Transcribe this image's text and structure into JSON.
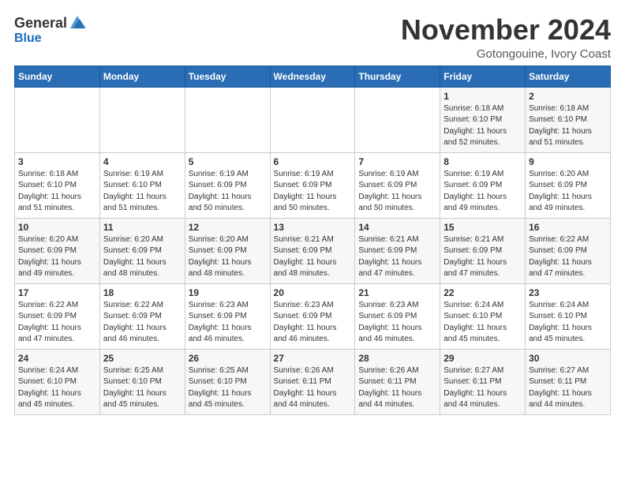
{
  "logo": {
    "general": "General",
    "blue": "Blue"
  },
  "header": {
    "month": "November 2024",
    "location": "Gotongouine, Ivory Coast"
  },
  "weekdays": [
    "Sunday",
    "Monday",
    "Tuesday",
    "Wednesday",
    "Thursday",
    "Friday",
    "Saturday"
  ],
  "weeks": [
    [
      {
        "day": "",
        "info": ""
      },
      {
        "day": "",
        "info": ""
      },
      {
        "day": "",
        "info": ""
      },
      {
        "day": "",
        "info": ""
      },
      {
        "day": "",
        "info": ""
      },
      {
        "day": "1",
        "info": "Sunrise: 6:18 AM\nSunset: 6:10 PM\nDaylight: 11 hours\nand 52 minutes."
      },
      {
        "day": "2",
        "info": "Sunrise: 6:18 AM\nSunset: 6:10 PM\nDaylight: 11 hours\nand 51 minutes."
      }
    ],
    [
      {
        "day": "3",
        "info": "Sunrise: 6:18 AM\nSunset: 6:10 PM\nDaylight: 11 hours\nand 51 minutes."
      },
      {
        "day": "4",
        "info": "Sunrise: 6:19 AM\nSunset: 6:10 PM\nDaylight: 11 hours\nand 51 minutes."
      },
      {
        "day": "5",
        "info": "Sunrise: 6:19 AM\nSunset: 6:09 PM\nDaylight: 11 hours\nand 50 minutes."
      },
      {
        "day": "6",
        "info": "Sunrise: 6:19 AM\nSunset: 6:09 PM\nDaylight: 11 hours\nand 50 minutes."
      },
      {
        "day": "7",
        "info": "Sunrise: 6:19 AM\nSunset: 6:09 PM\nDaylight: 11 hours\nand 50 minutes."
      },
      {
        "day": "8",
        "info": "Sunrise: 6:19 AM\nSunset: 6:09 PM\nDaylight: 11 hours\nand 49 minutes."
      },
      {
        "day": "9",
        "info": "Sunrise: 6:20 AM\nSunset: 6:09 PM\nDaylight: 11 hours\nand 49 minutes."
      }
    ],
    [
      {
        "day": "10",
        "info": "Sunrise: 6:20 AM\nSunset: 6:09 PM\nDaylight: 11 hours\nand 49 minutes."
      },
      {
        "day": "11",
        "info": "Sunrise: 6:20 AM\nSunset: 6:09 PM\nDaylight: 11 hours\nand 48 minutes."
      },
      {
        "day": "12",
        "info": "Sunrise: 6:20 AM\nSunset: 6:09 PM\nDaylight: 11 hours\nand 48 minutes."
      },
      {
        "day": "13",
        "info": "Sunrise: 6:21 AM\nSunset: 6:09 PM\nDaylight: 11 hours\nand 48 minutes."
      },
      {
        "day": "14",
        "info": "Sunrise: 6:21 AM\nSunset: 6:09 PM\nDaylight: 11 hours\nand 47 minutes."
      },
      {
        "day": "15",
        "info": "Sunrise: 6:21 AM\nSunset: 6:09 PM\nDaylight: 11 hours\nand 47 minutes."
      },
      {
        "day": "16",
        "info": "Sunrise: 6:22 AM\nSunset: 6:09 PM\nDaylight: 11 hours\nand 47 minutes."
      }
    ],
    [
      {
        "day": "17",
        "info": "Sunrise: 6:22 AM\nSunset: 6:09 PM\nDaylight: 11 hours\nand 47 minutes."
      },
      {
        "day": "18",
        "info": "Sunrise: 6:22 AM\nSunset: 6:09 PM\nDaylight: 11 hours\nand 46 minutes."
      },
      {
        "day": "19",
        "info": "Sunrise: 6:23 AM\nSunset: 6:09 PM\nDaylight: 11 hours\nand 46 minutes."
      },
      {
        "day": "20",
        "info": "Sunrise: 6:23 AM\nSunset: 6:09 PM\nDaylight: 11 hours\nand 46 minutes."
      },
      {
        "day": "21",
        "info": "Sunrise: 6:23 AM\nSunset: 6:09 PM\nDaylight: 11 hours\nand 46 minutes."
      },
      {
        "day": "22",
        "info": "Sunrise: 6:24 AM\nSunset: 6:10 PM\nDaylight: 11 hours\nand 45 minutes."
      },
      {
        "day": "23",
        "info": "Sunrise: 6:24 AM\nSunset: 6:10 PM\nDaylight: 11 hours\nand 45 minutes."
      }
    ],
    [
      {
        "day": "24",
        "info": "Sunrise: 6:24 AM\nSunset: 6:10 PM\nDaylight: 11 hours\nand 45 minutes."
      },
      {
        "day": "25",
        "info": "Sunrise: 6:25 AM\nSunset: 6:10 PM\nDaylight: 11 hours\nand 45 minutes."
      },
      {
        "day": "26",
        "info": "Sunrise: 6:25 AM\nSunset: 6:10 PM\nDaylight: 11 hours\nand 45 minutes."
      },
      {
        "day": "27",
        "info": "Sunrise: 6:26 AM\nSunset: 6:11 PM\nDaylight: 11 hours\nand 44 minutes."
      },
      {
        "day": "28",
        "info": "Sunrise: 6:26 AM\nSunset: 6:11 PM\nDaylight: 11 hours\nand 44 minutes."
      },
      {
        "day": "29",
        "info": "Sunrise: 6:27 AM\nSunset: 6:11 PM\nDaylight: 11 hours\nand 44 minutes."
      },
      {
        "day": "30",
        "info": "Sunrise: 6:27 AM\nSunset: 6:11 PM\nDaylight: 11 hours\nand 44 minutes."
      }
    ]
  ]
}
